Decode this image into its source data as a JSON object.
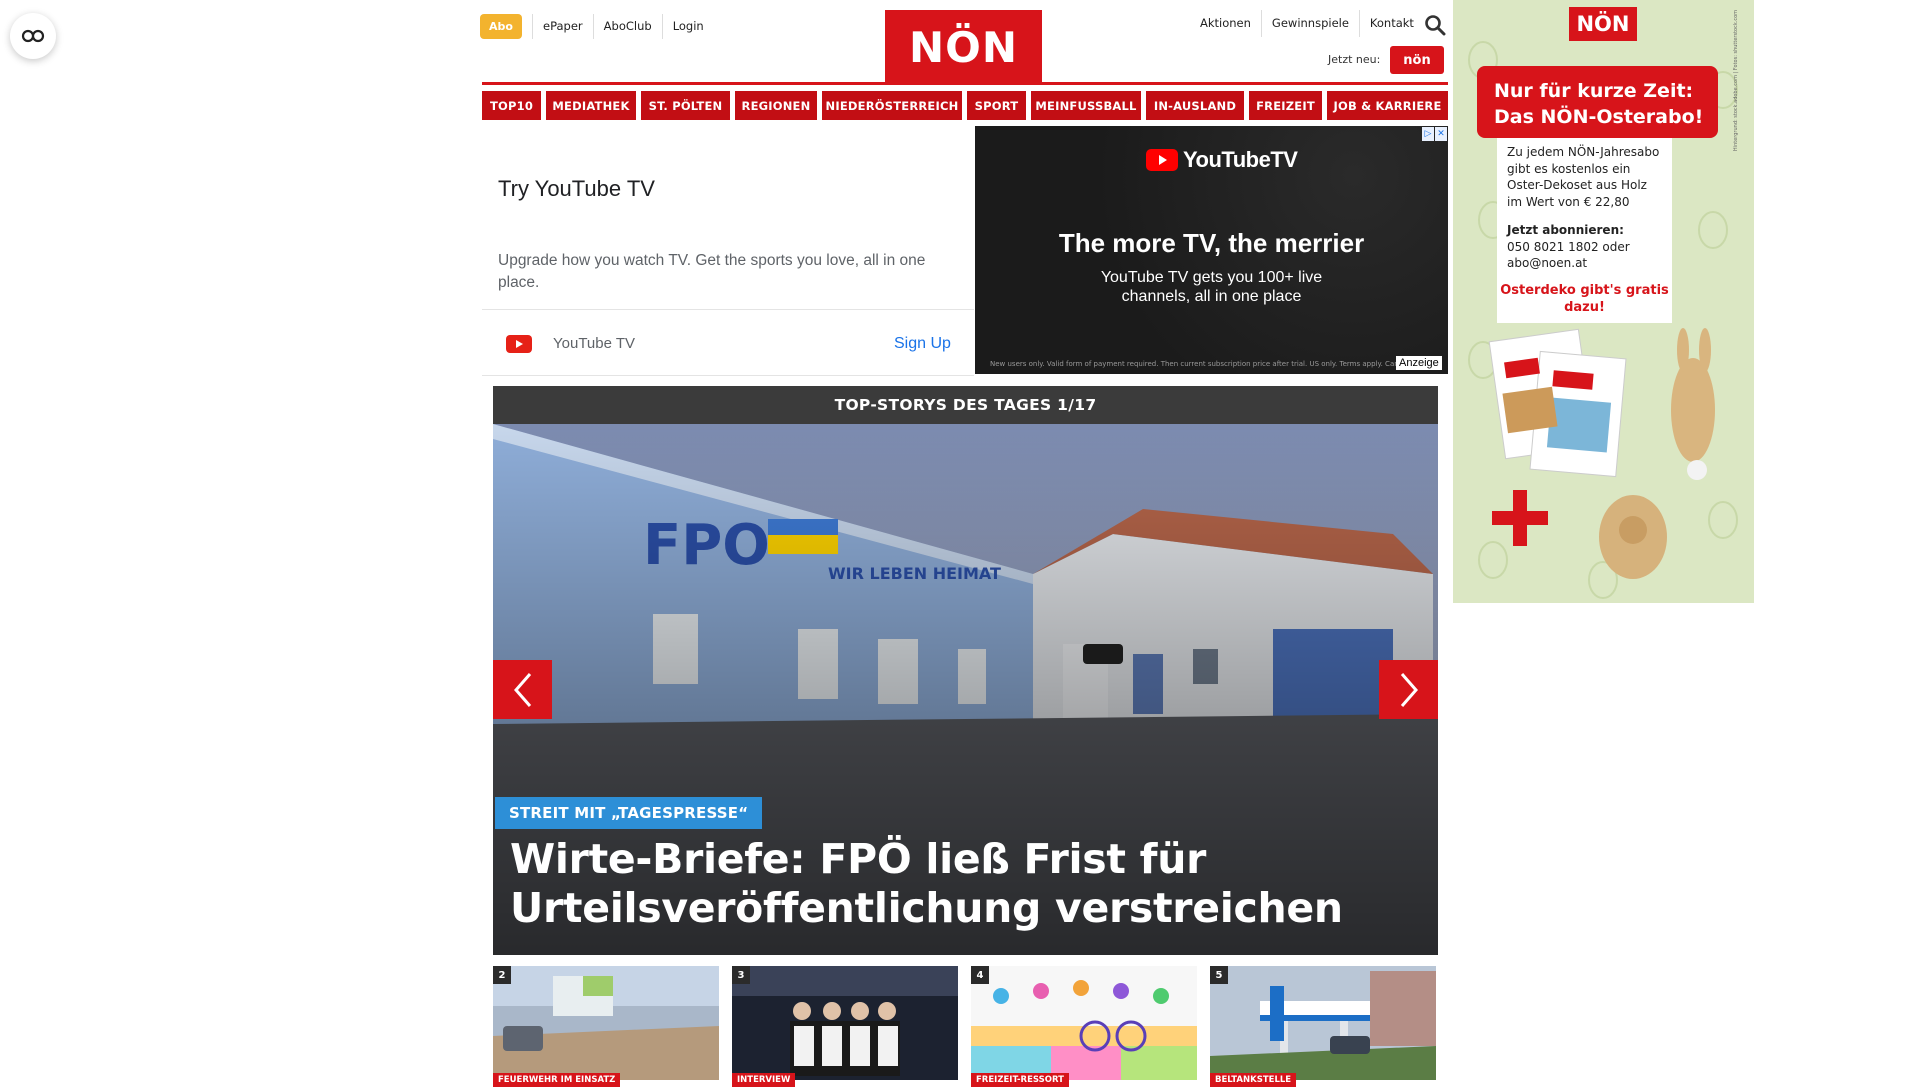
{
  "header": {
    "abo": "Abo",
    "top_links": [
      "ePaper",
      "AboClub",
      "Login"
    ],
    "logo": "NÖN",
    "right_links": [
      "Aktionen",
      "Gewinnspiele",
      "Kontakt"
    ],
    "jetzt_neu": "Jetzt neu:",
    "jetzt_badge": "nön"
  },
  "nav": [
    {
      "label": "TOP10"
    },
    {
      "label": "MEDIATHEK"
    },
    {
      "label": "ST. PÖLTEN"
    },
    {
      "label": "REGIONEN"
    },
    {
      "label": "NIEDERÖSTERREICH"
    },
    {
      "label": "SPORT"
    },
    {
      "label": "MEINFUSSBALL"
    },
    {
      "label": "IN-AUSLAND"
    },
    {
      "label": "FREIZEIT"
    },
    {
      "label": "JOB & KARRIERE"
    }
  ],
  "ad_youtube": {
    "title": "Try YouTube TV",
    "description": "Upgrade how you watch TV. Get the sports you love, all in one place.",
    "brand": "YouTube TV",
    "cta": "Sign Up",
    "logo_text": "YouTubeTV",
    "headline": "The more TV, the merrier",
    "subline": "YouTube TV gets you 100+ live channels, all in one place",
    "fine_print": "New users only. Valid form of payment required. Then current subscription price after trial. US only. Terms apply. Cancel anytime.",
    "anzeige": "Anzeige"
  },
  "top_stories": {
    "bar_title": "TOP-STORYS DES TAGES 1/17",
    "hero_tag": "STREIT MIT „TAGESPRESSE“",
    "hero_title": "Wirte-Briefe: FPÖ ließ Frist für Urteilsveröffentlichung verstreichen",
    "thumbs": [
      {
        "num": "2",
        "tag": "FEUERWEHR IM EINSATZ"
      },
      {
        "num": "3",
        "tag": "INTERVIEW"
      },
      {
        "num": "4",
        "tag": "FREIZEIT-RESSORT"
      },
      {
        "num": "5",
        "tag": "BELTANKSTELLE"
      }
    ]
  },
  "ad_right": {
    "logo": "NÖN",
    "banner": "Nur für kurze Zeit: Das NÖN-Osterabo!",
    "body": "Zu jedem NÖN-Jahresabo gibt es kostenlos ein Oster-Dekoset aus Holz im Wert von € 22,80",
    "cta_head": "Jetzt abonnieren:",
    "cta_body": "050 8021 1802 oder abo@noen.at",
    "oster": "Osterdeko gibt's gratis dazu!",
    "side_note": "Hintergrund: stock.adobe.com | Fotos: shutterstock.com"
  },
  "colors": {
    "brand_red": "#d7141a",
    "abo_yellow": "#f3b32e",
    "tag_blue": "#2d8fd7"
  }
}
